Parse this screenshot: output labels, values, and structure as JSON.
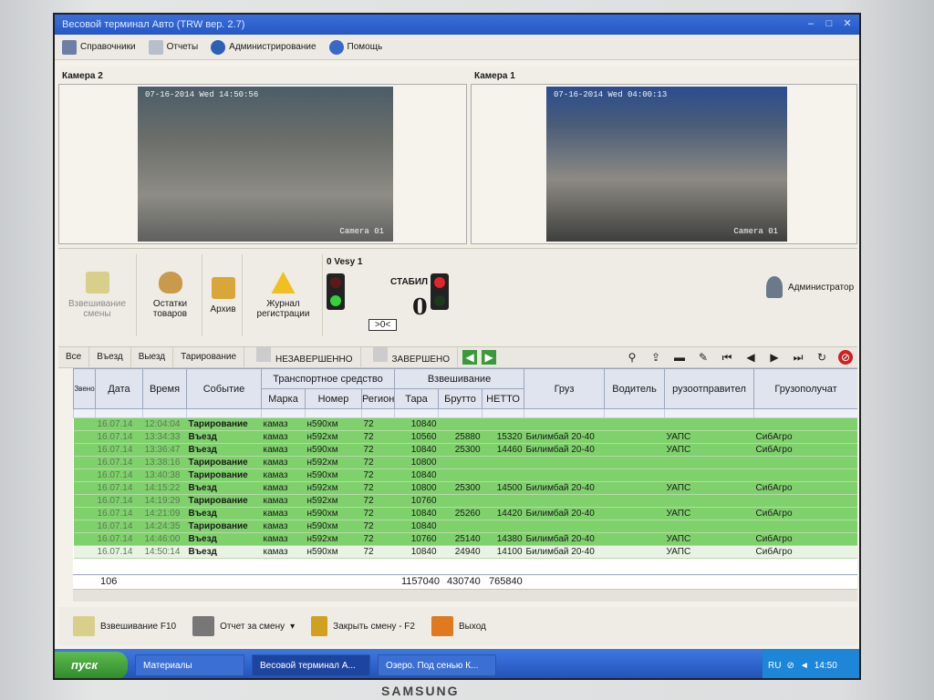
{
  "window": {
    "title": "Весовой терминал Авто (TRW вер. 2.7)"
  },
  "menu": {
    "items": [
      "Справочники",
      "Отчеты",
      "Администрирование",
      "Помощь"
    ]
  },
  "cameras": [
    {
      "label": "Камера 2",
      "stamp": "07-16-2014 Wed 14:50:56",
      "name": "Camera 01"
    },
    {
      "label": "Камера 1",
      "stamp": "07-16-2014 Wed 04:00:13",
      "name": "Camera 01"
    }
  ],
  "toolbar": {
    "buttons": [
      "Взвешивание смены",
      "Остатки товаров",
      "Архив",
      "Журнал регистрации"
    ],
    "user": "Администратор"
  },
  "scale": {
    "name": "0 Vesy 1",
    "status": "СТАБИЛ",
    "weight": "0",
    "zero_button": ">0<"
  },
  "filter_tabs": [
    "Все",
    "Въезд",
    "Выезд",
    "Тарирование",
    "НЕЗАВЕРШЕННО",
    "ЗАВЕРШЕНО"
  ],
  "grid": {
    "headers": {
      "date": "Дата",
      "time": "Время",
      "event": "Событие",
      "vehicle_group": "Транспортное средство",
      "make": "Марка",
      "number": "Номер",
      "region": "Регион",
      "weigh_group": "Взвешивание",
      "tare": "Тара",
      "gross": "Брутто",
      "net": "НЕТТО",
      "cargo": "Груз",
      "driver": "Водитель",
      "shipper": "рузоотправител",
      "consignee": "Грузополучат",
      "side": "Звено"
    },
    "rows": [
      {
        "date": "16.07.14",
        "time": "12:04:04",
        "event": "Тарирование",
        "make": "камаз",
        "number": "н590хм",
        "region": "72",
        "tare": "10840",
        "gross": "",
        "net": "",
        "cargo": "",
        "shipper": "",
        "consignee": ""
      },
      {
        "date": "16.07.14",
        "time": "13:34:33",
        "event": "Въезд",
        "make": "камаз",
        "number": "н592хм",
        "region": "72",
        "tare": "10560",
        "gross": "25880",
        "net": "15320",
        "cargo": "Билимбай 20-40",
        "shipper": "УАПС",
        "consignee": "СибАгро"
      },
      {
        "date": "16.07.14",
        "time": "13:36:47",
        "event": "Въезд",
        "make": "камаз",
        "number": "н590хм",
        "region": "72",
        "tare": "10840",
        "gross": "25300",
        "net": "14460",
        "cargo": "Билимбай 20-40",
        "shipper": "УАПС",
        "consignee": "СибАгро"
      },
      {
        "date": "16.07.14",
        "time": "13:38:16",
        "event": "Тарирование",
        "make": "камаз",
        "number": "н592хм",
        "region": "72",
        "tare": "10800",
        "gross": "",
        "net": "",
        "cargo": "",
        "shipper": "",
        "consignee": ""
      },
      {
        "date": "16.07.14",
        "time": "13:40:38",
        "event": "Тарирование",
        "make": "камаз",
        "number": "н590хм",
        "region": "72",
        "tare": "10840",
        "gross": "",
        "net": "",
        "cargo": "",
        "shipper": "",
        "consignee": ""
      },
      {
        "date": "16.07.14",
        "time": "14:15:22",
        "event": "Въезд",
        "make": "камаз",
        "number": "н592хм",
        "region": "72",
        "tare": "10800",
        "gross": "25300",
        "net": "14500",
        "cargo": "Билимбай 20-40",
        "shipper": "УАПС",
        "consignee": "СибАгро"
      },
      {
        "date": "16.07.14",
        "time": "14:19:29",
        "event": "Тарирование",
        "make": "камаз",
        "number": "н592хм",
        "region": "72",
        "tare": "10760",
        "gross": "",
        "net": "",
        "cargo": "",
        "shipper": "",
        "consignee": ""
      },
      {
        "date": "16.07.14",
        "time": "14:21:09",
        "event": "Въезд",
        "make": "камаз",
        "number": "н590хм",
        "region": "72",
        "tare": "10840",
        "gross": "25260",
        "net": "14420",
        "cargo": "Билимбай 20-40",
        "shipper": "УАПС",
        "consignee": "СибАгро"
      },
      {
        "date": "16.07.14",
        "time": "14:24:35",
        "event": "Тарирование",
        "make": "камаз",
        "number": "н590хм",
        "region": "72",
        "tare": "10840",
        "gross": "",
        "net": "",
        "cargo": "",
        "shipper": "",
        "consignee": ""
      },
      {
        "date": "16.07.14",
        "time": "14:46:00",
        "event": "Въезд",
        "make": "камаз",
        "number": "н592хм",
        "region": "72",
        "tare": "10760",
        "gross": "25140",
        "net": "14380",
        "cargo": "Билимбай 20-40",
        "shipper": "УАПС",
        "consignee": "СибАгро"
      },
      {
        "date": "16.07.14",
        "time": "14:50:14",
        "event": "Въезд",
        "make": "камаз",
        "number": "н590хм",
        "region": "72",
        "tare": "10840",
        "gross": "24940",
        "net": "14100",
        "cargo": "Билимбай 20-40",
        "shipper": "УАПС",
        "consignee": "СибАгро"
      }
    ],
    "totals": {
      "count": "106",
      "tare": "1157040",
      "gross": "430740",
      "net": "765840"
    }
  },
  "bottom": {
    "buttons": [
      "Взвешивание F10",
      "Отчет за смену",
      "Закрыть смену - F2",
      "Выход"
    ]
  },
  "taskbar": {
    "start": "пуск",
    "tasks": [
      "Материалы",
      "Весовой терминал А...",
      "Озеро. Под сенью К..."
    ],
    "lang": "RU",
    "clock": "14:50"
  },
  "monitor": {
    "brand": "SAMSUNG"
  },
  "colors": {
    "row_green": "#7fd16c",
    "current_row": "#e8f3e3",
    "title_blue": "#2557c4"
  }
}
